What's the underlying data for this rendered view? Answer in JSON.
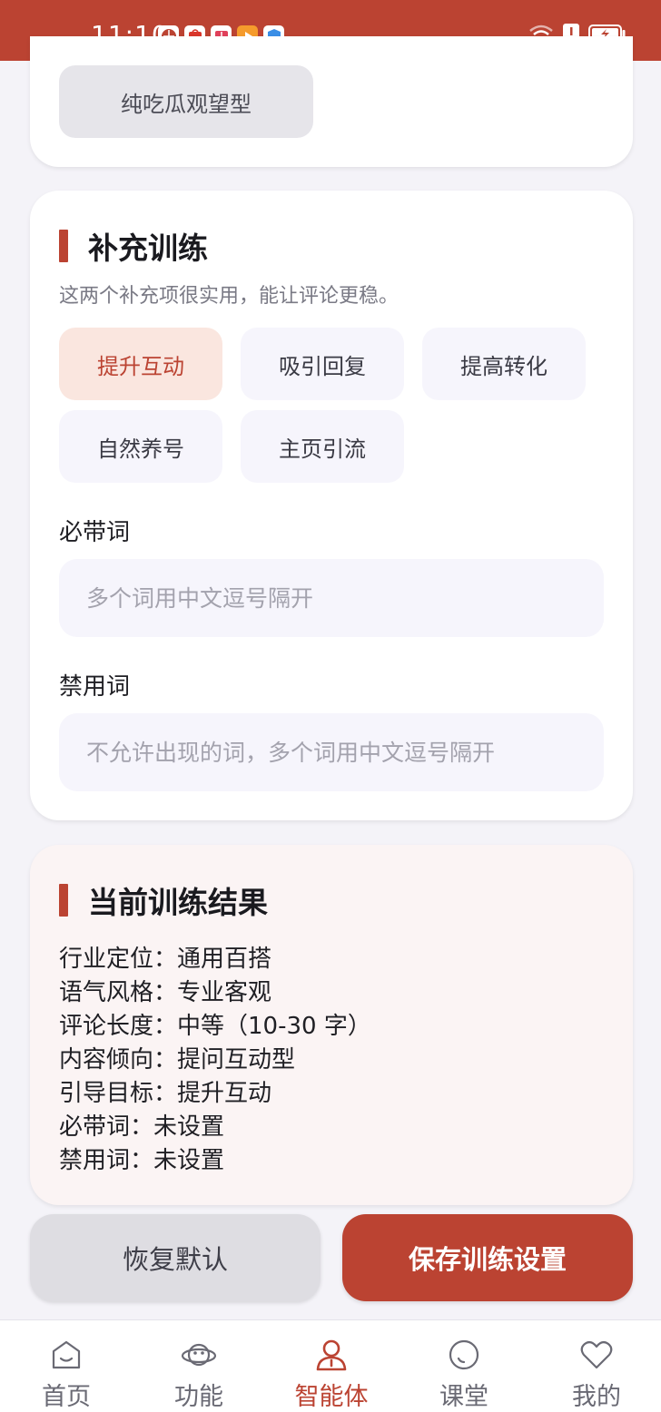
{
  "status_bar": {
    "time": "11:10",
    "app_icons": [
      "browser-icon",
      "huawei-store-icon",
      "reader-icon",
      "video-icon",
      "shield-icon"
    ],
    "indicators": [
      "wifi-icon",
      "alert-icon",
      "battery-charging-icon"
    ]
  },
  "top_card": {
    "option_label": "纯吃瓜观望型"
  },
  "supplement": {
    "title": "补充训练",
    "description": "这两个补充项很实用，能让评论更稳。",
    "options": [
      {
        "label": "提升互动",
        "selected": true
      },
      {
        "label": "吸引回复",
        "selected": false
      },
      {
        "label": "提高转化",
        "selected": false
      },
      {
        "label": "自然养号",
        "selected": false
      },
      {
        "label": "主页引流",
        "selected": false
      }
    ],
    "required_words": {
      "label": "必带词",
      "value": "",
      "placeholder": "多个词用中文逗号隔开"
    },
    "banned_words": {
      "label": "禁用词",
      "value": "",
      "placeholder": "不允许出现的词，多个词用中文逗号隔开"
    }
  },
  "result": {
    "title": "当前训练结果",
    "lines": [
      "行业定位：通用百搭",
      "语气风格：专业客观",
      "评论长度：中等（10-30 字）",
      "内容倾向：提问互动型",
      "引导目标：提升互动",
      "必带词：未设置",
      "禁用词：未设置"
    ]
  },
  "actions": {
    "reset_label": "恢复默认",
    "save_label": "保存训练设置"
  },
  "bottom_nav": {
    "items": [
      {
        "label": "首页",
        "icon": "home-icon",
        "active": false
      },
      {
        "label": "功能",
        "icon": "planet-icon",
        "active": false
      },
      {
        "label": "智能体",
        "icon": "agent-icon",
        "active": true
      },
      {
        "label": "课堂",
        "icon": "classroom-icon",
        "active": false
      },
      {
        "label": "我的",
        "icon": "heart-icon",
        "active": false
      }
    ]
  },
  "colors": {
    "accent": "#bb4332",
    "page_bg": "#f4f3f8",
    "chip_selected_bg": "#fae6df",
    "result_bg": "#fbf4f4"
  }
}
